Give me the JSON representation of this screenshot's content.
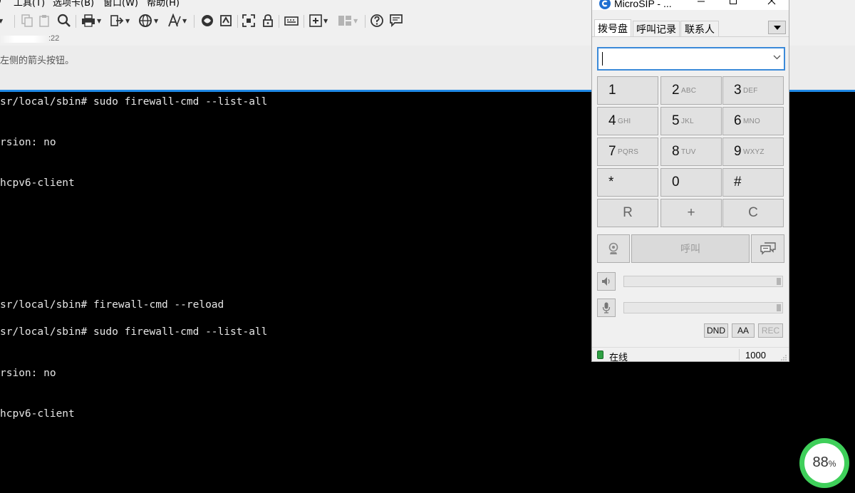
{
  "background_app": {
    "menu": [
      ")",
      "工具(T)",
      "选项卡(B)",
      "窗口(W)",
      "帮助(H)"
    ],
    "toolbar_icons": [
      "new-window-icon",
      "copy-icon",
      "paste-icon",
      "find-icon",
      "print-icon",
      "transfer-icon",
      "globe-icon",
      "font-icon",
      "session-icon",
      "script-icon",
      "fullscreen-icon",
      "lock-icon",
      "keyboard-icon",
      "new-tab-icon",
      "layout-icon",
      "help-icon",
      "chat-icon"
    ],
    "session_time": ":22",
    "info_text": "击左侧的箭头按钮。",
    "accent_color": "#1e88e5"
  },
  "terminal": {
    "lines": [
      "sr/local/sbin# sudo firewall-cmd --list-all",
      "rsion: no",
      "hcpv6-client",
      "sr/local/sbin# firewall-cmd --reload",
      "sr/local/sbin# sudo firewall-cmd --list-all",
      "rsion: no",
      "hcpv6-client"
    ],
    "text_color": "#e6e6e6"
  },
  "microsip": {
    "title": "MicroSIP - ...",
    "tabs": [
      "拨号盘",
      "呼叫记录",
      "联系人"
    ],
    "number_input": {
      "value": "",
      "placeholder": ""
    },
    "keys": [
      {
        "digit": "1",
        "letters": ""
      },
      {
        "digit": "2",
        "letters": "ABC"
      },
      {
        "digit": "3",
        "letters": "DEF"
      },
      {
        "digit": "4",
        "letters": "GHI"
      },
      {
        "digit": "5",
        "letters": "JKL"
      },
      {
        "digit": "6",
        "letters": "MNO"
      },
      {
        "digit": "7",
        "letters": "PQRS"
      },
      {
        "digit": "8",
        "letters": "TUV"
      },
      {
        "digit": "9",
        "letters": "WXYZ"
      },
      {
        "digit": "*",
        "letters": ""
      },
      {
        "digit": "0",
        "letters": ""
      },
      {
        "digit": "#",
        "letters": ""
      }
    ],
    "controls": {
      "redial": "R",
      "plus": "+",
      "clear": "C"
    },
    "call_label": "呼叫",
    "buttons": {
      "dnd": "DND",
      "aa": "AA",
      "rec": "REC"
    },
    "speaker_level": 1.0,
    "mic_level": 1.0,
    "status": {
      "text": "在线",
      "number": "1000",
      "color": "#2ea043"
    }
  },
  "meter": {
    "value": "88",
    "unit": "%",
    "color": "#3fcf5a"
  }
}
